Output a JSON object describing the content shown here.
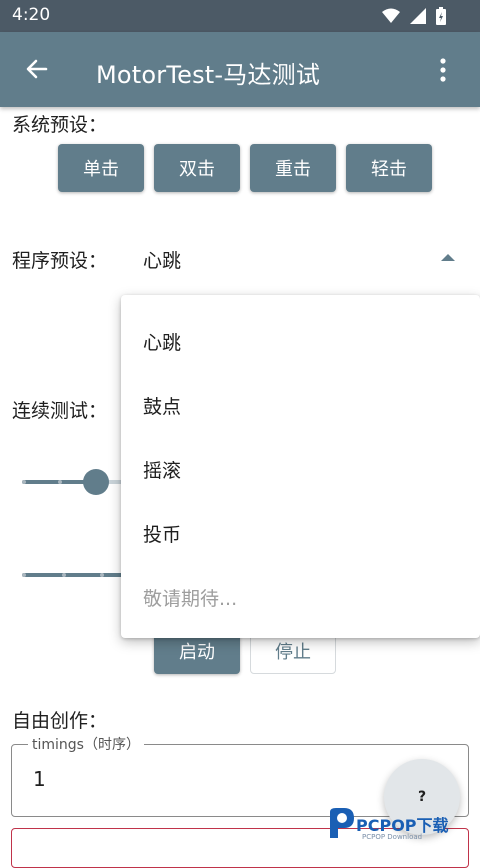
{
  "status_bar": {
    "time": "4:20",
    "icons": [
      "wifi-icon",
      "signal-icon",
      "battery-icon"
    ]
  },
  "app_bar": {
    "title": "MotorTest-马达测试",
    "back_icon": "arrow-back-icon",
    "menu_icon": "more-vert-icon"
  },
  "system_presets": {
    "label": "系统预设：",
    "buttons": [
      "单击",
      "双击",
      "重击",
      "轻击"
    ]
  },
  "program_presets": {
    "label": "程序预设：",
    "selected": "心跳",
    "options": [
      "心跳",
      "鼓点",
      "摇滚",
      "投币",
      "敬请期待..."
    ]
  },
  "continuous_test": {
    "label": "连续测试：",
    "start_label": "启动",
    "stop_label": "停止"
  },
  "free_creation": {
    "label": "自由创作：",
    "timings_label": "timings（时序）",
    "timings_value": "1"
  },
  "fab": {
    "label": "?"
  },
  "watermark": {
    "text": "PCPOP下载",
    "subtext": "PCPOP Download"
  },
  "colors": {
    "primary": "#617d8b",
    "status_bar": "#4c5a66",
    "error": "#c0334a"
  }
}
